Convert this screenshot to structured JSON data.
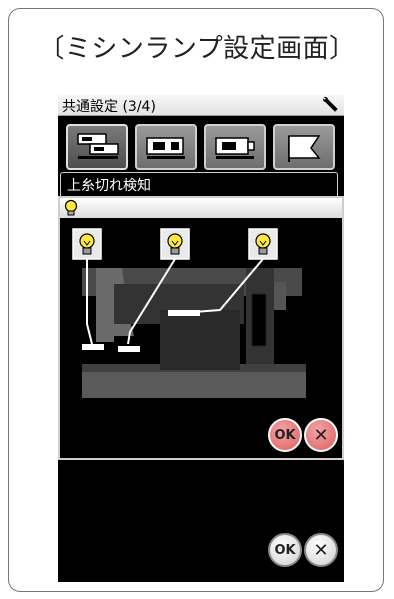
{
  "caption": "〔ミシンランプ設定画面〕",
  "screen": {
    "title": "共通設定 (3/4)",
    "title_icon": "wrench-icon",
    "tabs": [
      {
        "icon": "sewing-machine-bed-icon",
        "active": true
      },
      {
        "icon": "sewing-machine-icon",
        "active": false
      },
      {
        "icon": "sewing-machine-lamp-icon",
        "active": false
      },
      {
        "icon": "flag-icon",
        "active": false
      }
    ],
    "setting_label": "上糸切れ検知",
    "popup": {
      "header_icon": "lightbulb-icon",
      "lamp_icons": [
        "lightbulb-icon",
        "lightbulb-icon",
        "lightbulb-icon"
      ],
      "ok_label": "OK",
      "cancel_icon": "close-icon"
    },
    "footer": {
      "ok_label": "OK",
      "cancel_icon": "close-icon"
    }
  },
  "colors": {
    "screen_bg": "#000000",
    "accent_pink": "#e06464",
    "bulb_yellow": "#ffe640"
  }
}
